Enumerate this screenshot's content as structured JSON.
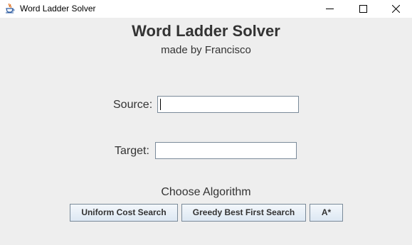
{
  "window": {
    "title": "Word Ladder Solver",
    "icon": "java-cup-icon",
    "controls": [
      "minimize-icon",
      "maximize-icon",
      "close-icon"
    ]
  },
  "header": {
    "title": "Word Ladder Solver",
    "subtitle": "made by Francisco"
  },
  "form": {
    "source_label": "Source:",
    "source_value": "",
    "target_label": "Target:",
    "target_value": ""
  },
  "algorithms": {
    "prompt": "Choose Algorithm",
    "buttons": [
      "Uniform Cost Search",
      "Greedy Best First Search",
      "A*"
    ]
  },
  "colors": {
    "background": "#eeeeee",
    "text": "#333333",
    "field_border": "#7a8a99",
    "button_top": "#f3f7fb",
    "button_bottom": "#dde8f3"
  }
}
